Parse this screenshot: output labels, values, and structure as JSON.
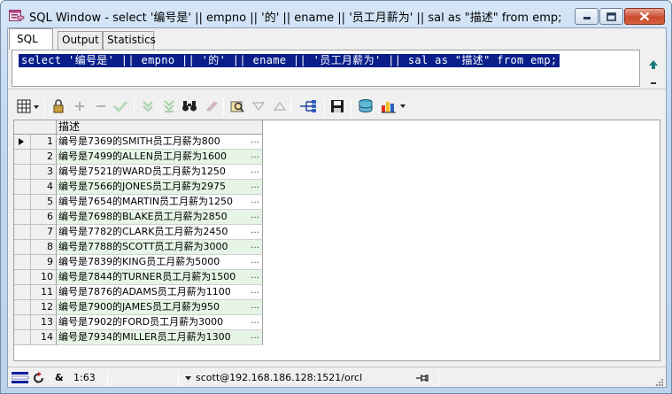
{
  "window": {
    "title": "SQL Window - select '编号是' || empno || '的' || ename || '员工月薪为' || sal as \"描述\" from emp;",
    "min_label": "minimize",
    "max_label": "maximize",
    "close_label": "close"
  },
  "tabs": [
    {
      "label": "SQL",
      "active": true
    },
    {
      "label": "Output",
      "active": false
    },
    {
      "label": "Statistics",
      "active": false
    }
  ],
  "editor": {
    "sql": "select '编号是' || empno || '的' || ename || '员工月薪为' || sal as \"描述\" from emp;"
  },
  "grid": {
    "column": "描述",
    "cell_button": "…",
    "rows": [
      {
        "num": "1",
        "value": "编号是7369的SMITH员工月薪为800"
      },
      {
        "num": "2",
        "value": "编号是7499的ALLEN员工月薪为1600"
      },
      {
        "num": "3",
        "value": "编号是7521的WARD员工月薪为1250"
      },
      {
        "num": "4",
        "value": "编号是7566的JONES员工月薪为2975"
      },
      {
        "num": "5",
        "value": "编号是7654的MARTIN员工月薪为1250"
      },
      {
        "num": "6",
        "value": "编号是7698的BLAKE员工月薪为2850"
      },
      {
        "num": "7",
        "value": "编号是7782的CLARK员工月薪为2450"
      },
      {
        "num": "8",
        "value": "编号是7788的SCOTT员工月薪为3000"
      },
      {
        "num": "9",
        "value": "编号是7839的KING员工月薪为5000"
      },
      {
        "num": "10",
        "value": "编号是7844的TURNER员工月薪为1500"
      },
      {
        "num": "11",
        "value": "编号是7876的ADAMS员工月薪为1100"
      },
      {
        "num": "12",
        "value": "编号是7900的JAMES员工月薪为950"
      },
      {
        "num": "13",
        "value": "编号是7902的FORD员工月薪为3000"
      },
      {
        "num": "14",
        "value": "编号是7934的MILLER员工月薪为1300"
      }
    ]
  },
  "statusbar": {
    "cursor": "1:63",
    "connection": "scott@192.168.186.128:1521/orcl"
  },
  "colors": {
    "selection": "#0a1f8a",
    "row_alt": "#e6f5e6",
    "close_button": "#c94a2e"
  }
}
